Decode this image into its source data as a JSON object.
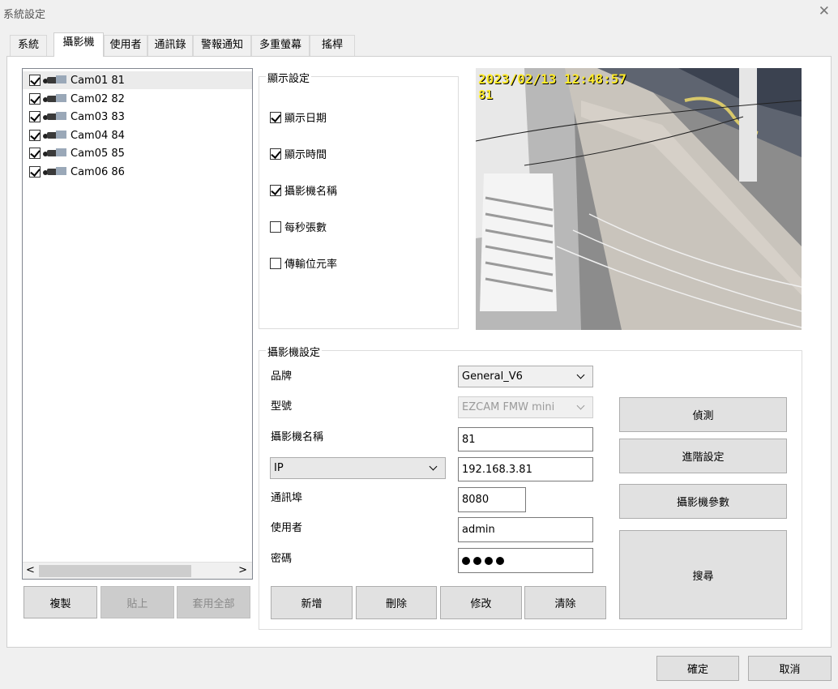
{
  "window": {
    "title": "系統設定",
    "close_glyph": "✕"
  },
  "tabs": [
    "系統",
    "攝影機",
    "使用者",
    "通訊錄",
    "警報通知",
    "多重螢幕",
    "搖桿"
  ],
  "active_tab": "攝影機",
  "camera_list": [
    {
      "label": "Cam01 81",
      "checked": true,
      "selected": true
    },
    {
      "label": "Cam02 82",
      "checked": true
    },
    {
      "label": "Cam03 83",
      "checked": true
    },
    {
      "label": "Cam04 84",
      "checked": true
    },
    {
      "label": "Cam05 85",
      "checked": true
    },
    {
      "label": "Cam06 86",
      "checked": true
    }
  ],
  "scroll": {
    "left_glyph": "<",
    "right_glyph": ">"
  },
  "list_buttons": {
    "copy": "複製",
    "paste": "貼上",
    "apply_all": "套用全部"
  },
  "display": {
    "legend": "顯示設定",
    "options": [
      {
        "label": "顯示日期",
        "checked": true
      },
      {
        "label": "顯示時間",
        "checked": true
      },
      {
        "label": "攝影機名稱",
        "checked": true
      },
      {
        "label": "每秒張數",
        "checked": false
      },
      {
        "label": "傳輸位元率",
        "checked": false
      }
    ]
  },
  "preview": {
    "osd_datetime": "2023/02/13 12:48:57",
    "osd_name": "81"
  },
  "camera_settings": {
    "legend": "攝影機設定",
    "brand_label": "品牌",
    "brand_value": "General_V6",
    "model_label": "型號",
    "model_value": "EZCAM FMW mini",
    "name_label": "攝影機名稱",
    "name_value": "81",
    "address_type": "IP",
    "address_value": "192.168.3.81",
    "port_label": "通訊埠",
    "port_value": "8080",
    "user_label": "使用者",
    "user_value": "admin",
    "password_label": "密碼"
  },
  "action_buttons": {
    "detect": "偵測",
    "advanced": "進階設定",
    "camera_params": "攝影機參數",
    "search": "搜尋"
  },
  "edit_buttons": {
    "add": "新增",
    "delete": "刪除",
    "modify": "修改",
    "clear": "清除"
  },
  "footer": {
    "ok": "確定",
    "cancel": "取消"
  }
}
